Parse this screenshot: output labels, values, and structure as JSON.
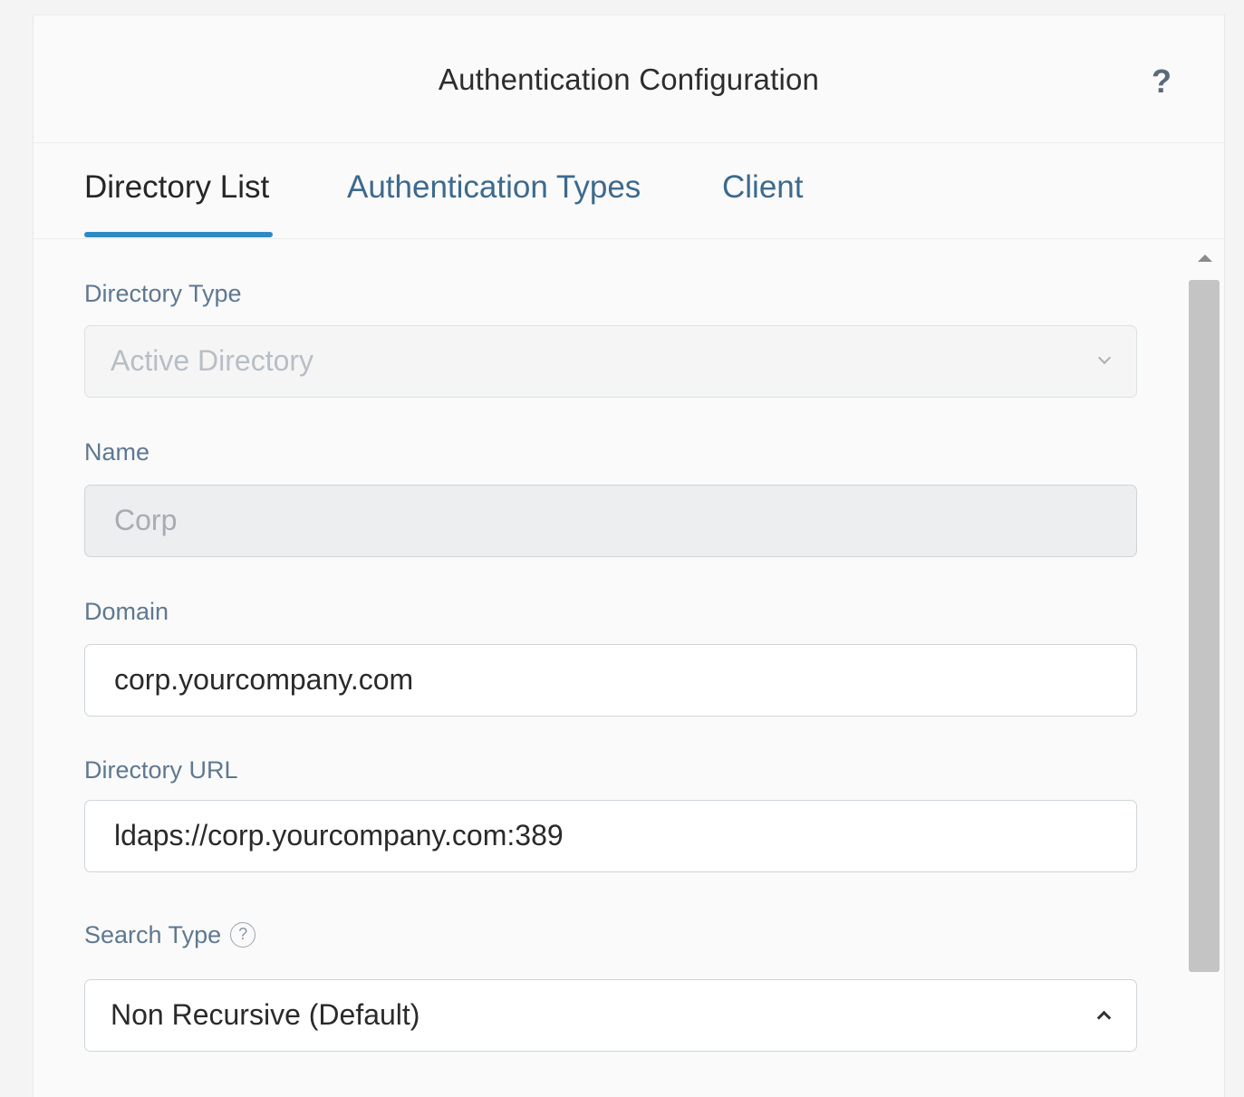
{
  "header": {
    "title": "Authentication Configuration",
    "help_glyph": "?"
  },
  "tabs": [
    {
      "label": "Directory List",
      "active": true
    },
    {
      "label": "Authentication Types",
      "active": false
    },
    {
      "label": "Client",
      "active": false
    }
  ],
  "form": {
    "directory_type": {
      "label": "Directory Type",
      "value": "Active Directory",
      "disabled": true
    },
    "name": {
      "label": "Name",
      "value": "Corp",
      "readonly": true
    },
    "domain": {
      "label": "Domain",
      "value": "corp.yourcompany.com"
    },
    "directory_url": {
      "label": "Directory URL",
      "value": "ldaps://corp.yourcompany.com:389"
    },
    "search_type": {
      "label": "Search Type",
      "info_glyph": "?",
      "value": "Non Recursive (Default)",
      "expanded": true
    }
  },
  "colors": {
    "accent": "#2f8ac4",
    "tab_inactive": "#3d6a8d",
    "label": "#5f7890"
  },
  "icons": {
    "help": "help-question-icon",
    "info": "info-circle-icon",
    "dropdown_closed": "chevron-down-icon",
    "dropdown_open": "chevron-up-icon"
  }
}
